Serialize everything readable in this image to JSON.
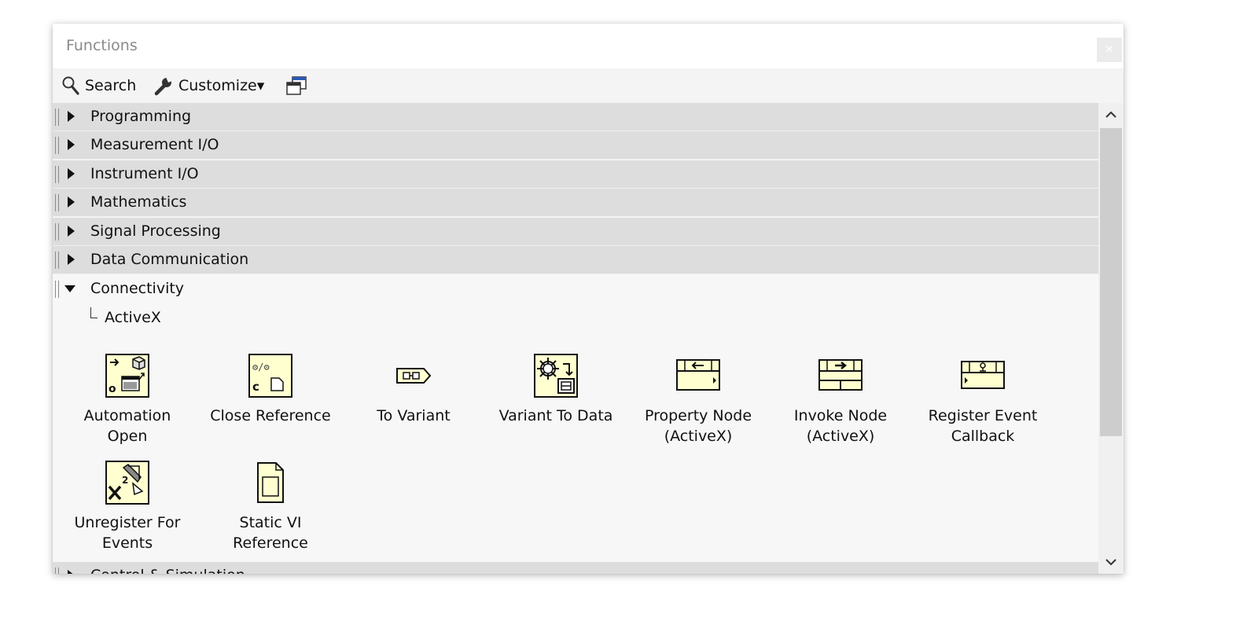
{
  "window": {
    "title": "Functions"
  },
  "toolbar": {
    "search_label": "Search",
    "customize_label": "Customize▾"
  },
  "categories": [
    {
      "label": "Programming"
    },
    {
      "label": "Measurement I/O"
    },
    {
      "label": "Instrument I/O"
    },
    {
      "label": "Mathematics"
    },
    {
      "label": "Signal Processing"
    },
    {
      "label": "Data Communication"
    },
    {
      "label": "Connectivity"
    },
    {
      "label": "Control & Simulation"
    }
  ],
  "subpalette": {
    "label": "ActiveX"
  },
  "functions": [
    {
      "label": "Automation\nOpen",
      "icon": "automation-open-icon"
    },
    {
      "label": "Close Reference",
      "icon": "close-reference-icon"
    },
    {
      "label": "To Variant",
      "icon": "to-variant-icon"
    },
    {
      "label": "Variant To Data",
      "icon": "variant-to-data-icon"
    },
    {
      "label": "Property Node\n(ActiveX)",
      "icon": "property-node-icon"
    },
    {
      "label": "Invoke Node\n(ActiveX)",
      "icon": "invoke-node-icon"
    },
    {
      "label": "Register Event\nCallback",
      "icon": "register-event-callback-icon"
    },
    {
      "label": "Unregister For\nEvents",
      "icon": "unregister-events-icon"
    },
    {
      "label": "Static VI\nReference",
      "icon": "static-vi-reference-icon"
    }
  ],
  "colors": {
    "category_bg": "#dddddd",
    "icon_fill": "#ffffd0",
    "scroll_thumb": "#cdcdcd"
  }
}
